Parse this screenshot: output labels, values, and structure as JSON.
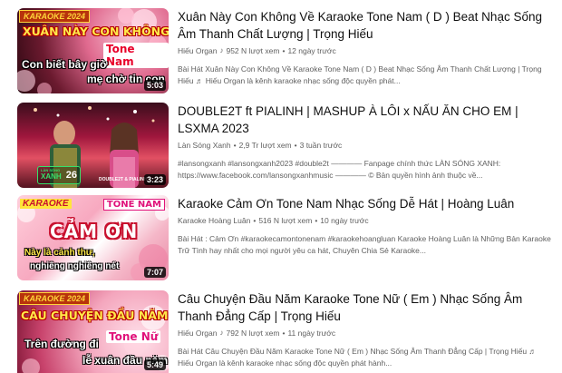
{
  "videos": [
    {
      "title": "Xuân Này Con Không Về Karaoke Tone Nam ( D ) Beat Nhạc Sống Âm Thanh Chất Lượng | Trọng Hiếu",
      "channel": "Hiếu Organ",
      "has_music_icon": true,
      "views": "952 N lượt xem",
      "age": "12 ngày trước",
      "description": "Bài Hát Xuân Này Con Không Về Karaoke Tone Nam ( D ) Beat Nhạc Sống Âm Thanh Chất Lượng | Trọng Hiếu ♬ Hiếu Organ là kênh karaoke nhạc sống độc quyền phát...",
      "duration": "5:03",
      "thumb": {
        "tag": "KARAOKE 2024",
        "headline": "XUÂN NÀY CON KHÔNG VỀ",
        "tone": "Tone Nam",
        "lyric1": "Con biết bây giờ",
        "lyric2": "mẹ chờ tin con"
      }
    },
    {
      "title": "DOUBLE2T ft PIALINH | MASHUP À LÔI x NẤU ĂN CHO EM | LSXMA 2023",
      "channel": "Làn Sóng Xanh",
      "has_music_icon": false,
      "views": "2,9 Tr lượt xem",
      "age": "3 tuần trước",
      "description": "#lansongxanh #lansongxanh2023 #double2t ———— Fanpage chính thức LÀN SÓNG XANH: https://www.facebook.com/lansongxanhmusic ———— © Bản quyền hình ảnh thuộc về...",
      "duration": "3:23",
      "thumb": {
        "badge_top": "LÀN SÓNG",
        "badge_main": "XANH",
        "badge_num": "26",
        "caption": "DOUBLE2T & PIALINH"
      }
    },
    {
      "title": "Karaoke Cảm Ơn Tone Nam Nhạc Sống Dễ Hát | Hoàng Luân",
      "channel": "Karaoke Hoàng Luân",
      "has_music_icon": false,
      "views": "516 N lượt xem",
      "age": "10 ngày trước",
      "description": "Bài Hát : Cảm Ơn #karaokecamontonenam #karaokehoangluan Karaoke Hoàng Luân là Những Bản Karaoke Trữ Tình hay nhất cho mọi người yêu ca hát, Chuyên Chia Sẻ Karaoke...",
      "duration": "7:07",
      "thumb": {
        "tag": "KARAOKE",
        "headline": "CẢM ƠN",
        "tone": "TONE NAM",
        "lyric1": "Này là cảnh thư,",
        "lyric2": "nghiêng nghiêng nét"
      }
    },
    {
      "title": "Câu Chuyện Đầu Năm Karaoke Tone Nữ ( Em ) Nhạc Sống Âm Thanh Đẳng Cấp | Trọng Hiếu",
      "channel": "Hiếu Organ",
      "has_music_icon": true,
      "views": "792 N lượt xem",
      "age": "11 ngày trước",
      "description": "Bài Hát Câu Chuyện Đầu Năm Karaoke Tone Nữ ( Em ) Nhạc Sống Âm Thanh Đẳng Cấp | Trọng Hiếu ♬ Hiếu Organ là kênh karaoke nhạc sống độc quyền phát hành...",
      "duration": "5:49",
      "thumb": {
        "tag": "KARAOKE 2024",
        "headline": "CÂU CHUYỆN ĐẦU NĂM",
        "tone": "Tone Nữ",
        "lyric1": "Trên đường đi",
        "lyric2": "lễ xuân đầu năm"
      }
    }
  ],
  "meta_separator": "•",
  "music_icon": "music-note-icon",
  "colors": {
    "title": "#0f0f0f",
    "meta": "#606060",
    "duration_bg": "#000000",
    "karaoke_red": "#c8102e",
    "tone_pink": "#e0127a"
  }
}
